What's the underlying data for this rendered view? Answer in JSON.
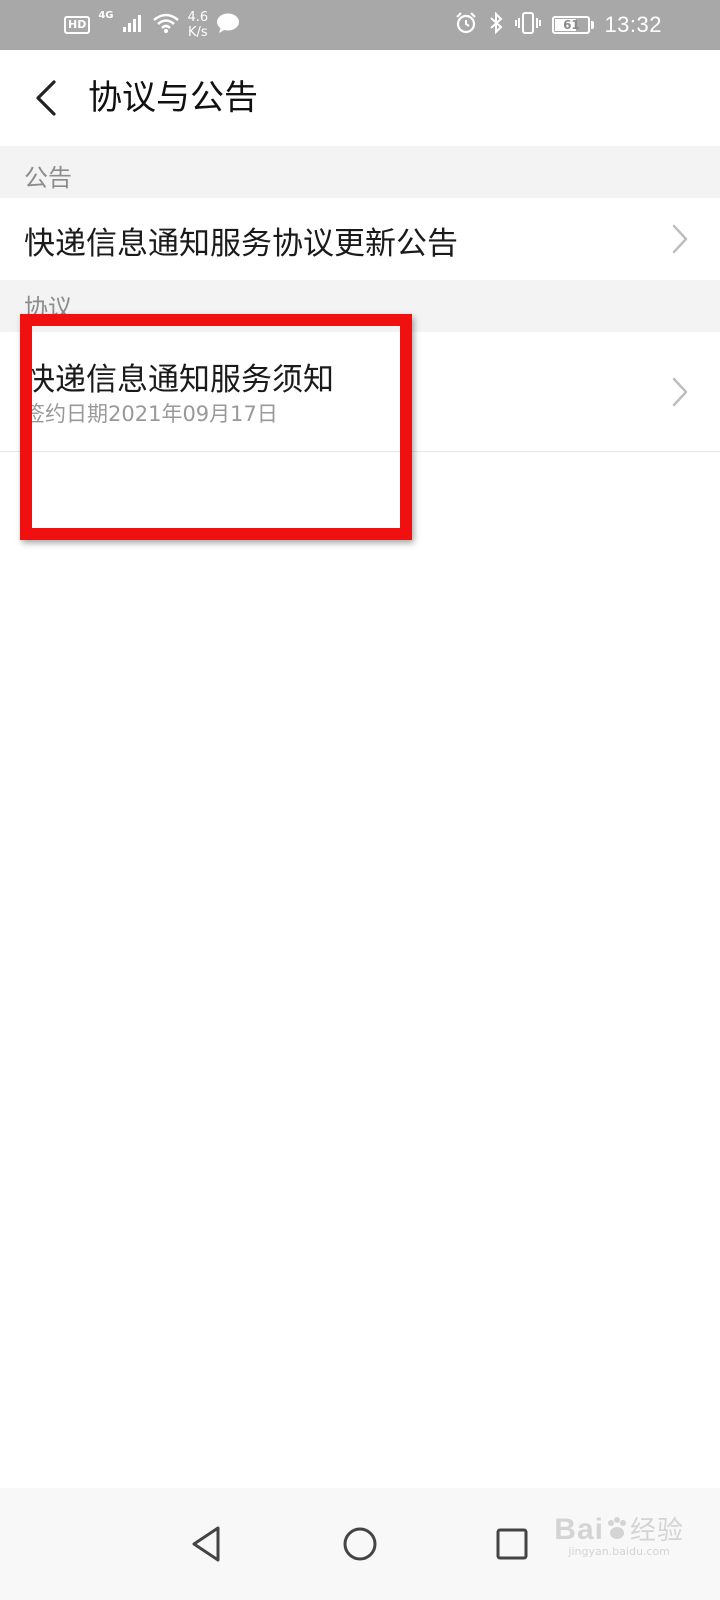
{
  "status_bar": {
    "hd": "HD",
    "network_generation": "4G",
    "net_speed_value": "4.6",
    "net_speed_unit": "K/s",
    "battery_level": "61",
    "time": "13:32",
    "icons": [
      "hd-icon",
      "signal-icon",
      "wifi-icon",
      "message-icon",
      "alarm-icon",
      "bluetooth-icon",
      "vibrate-icon",
      "battery-icon"
    ]
  },
  "header": {
    "title": "协议与公告",
    "back_icon": "chevron-left-icon"
  },
  "sections": [
    {
      "header": "公告",
      "items": [
        {
          "title": "快递信息通知服务协议更新公告",
          "icon": "chevron-right-icon"
        }
      ]
    },
    {
      "header": "协议",
      "items": [
        {
          "title": "快递信息通知服务须知",
          "subtitle": "签约日期2021年09月17日",
          "icon": "chevron-right-icon"
        }
      ]
    }
  ],
  "annotation": {
    "color": "#f01010"
  },
  "nav_bar": {
    "icons": [
      "nav-back-icon",
      "nav-home-icon",
      "nav-recent-icon"
    ]
  },
  "watermark": {
    "brand": "Bai",
    "brand_suffix": "经验",
    "site": "jingyan.baidu.com"
  },
  "colors": {
    "status_bar_bg": "#a8a8a8",
    "section_bg": "#f3f3f3",
    "primary_text": "#1a1a1a",
    "secondary_text": "#999999"
  }
}
